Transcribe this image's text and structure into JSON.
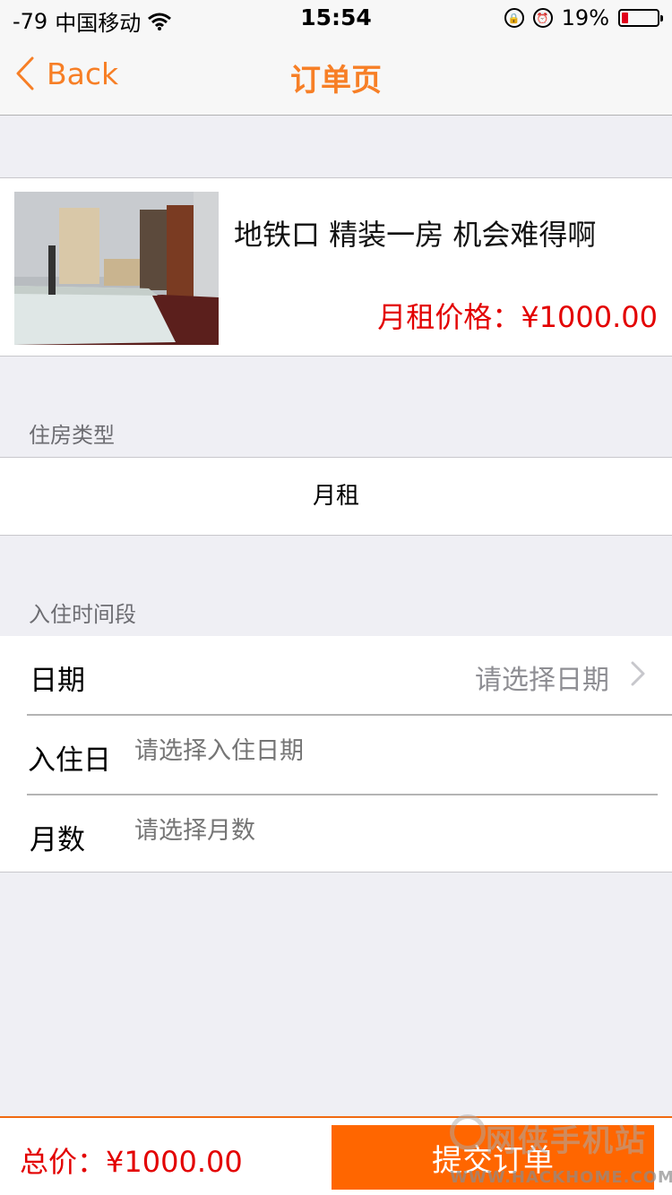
{
  "status_bar": {
    "signal": "-79",
    "carrier": "中国移动",
    "time": "15:54",
    "battery_percent_label": "19%",
    "battery_level": 0.19
  },
  "nav": {
    "back_label": "Back",
    "title": "订单页"
  },
  "product": {
    "title": "地铁口 精装一房 机会难得啊",
    "price_label": "月租价格：",
    "price": "¥1000.00"
  },
  "sections": {
    "housing_type_label": "住房类型",
    "housing_type_value": "月租",
    "stay_period_label": "入住时间段"
  },
  "form": {
    "date_label": "日期",
    "date_value": "请选择日期",
    "checkin_label": "入住日",
    "checkin_placeholder": "请选择入住日期",
    "months_label": "月数",
    "months_placeholder": "请选择月数"
  },
  "footer": {
    "total_label": "总价：",
    "total_value": "¥1000.00",
    "submit_label": "提交订单"
  },
  "watermark": {
    "main": "网侠手机站",
    "sub": "WWW.HACKHOME.COM"
  },
  "colors": {
    "accent": "#f77f26",
    "price_red": "#e30000",
    "submit_orange": "#ff6600"
  }
}
